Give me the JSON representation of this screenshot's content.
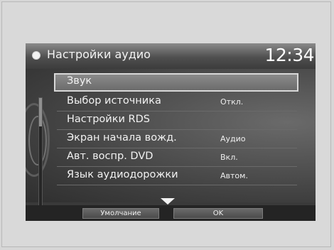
{
  "header": {
    "title": "Настройки аудио",
    "clock": "12:34"
  },
  "menu": {
    "items": [
      {
        "label": "Звук",
        "value": ""
      },
      {
        "label": "Выбор источника",
        "value": "Откл."
      },
      {
        "label": "Настройки RDS",
        "value": ""
      },
      {
        "label": "Экран начала вожд.",
        "value": "Аудио"
      },
      {
        "label": "Авт. воспр. DVD",
        "value": "Вкл."
      },
      {
        "label": "Язык аудиодорожки",
        "value": "Автом."
      }
    ],
    "selected_index": 0
  },
  "softkeys": {
    "default_label": "Умолчание",
    "ok_label": "OK"
  },
  "icons": {
    "title_bullet": "circle-bullet-icon",
    "scroll_down": "down-arrow-icon"
  }
}
